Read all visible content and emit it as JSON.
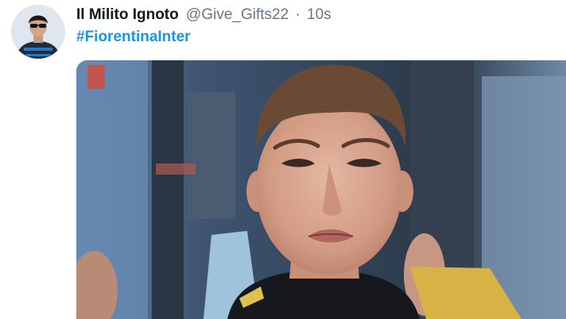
{
  "tweet": {
    "author": {
      "display_name": "Il Milito Ignoto",
      "handle": "@Give_Gifts22",
      "avatar_icon": "user-avatar"
    },
    "separator": "·",
    "timestamp": "10s",
    "hashtag": "#FiorentinaInter",
    "media": {
      "kind": "photo",
      "subject": "football-player-pouting"
    }
  },
  "colors": {
    "text_primary": "#14171a",
    "text_secondary": "#657786",
    "link": "#1b95e0",
    "background": "#ffffff"
  }
}
